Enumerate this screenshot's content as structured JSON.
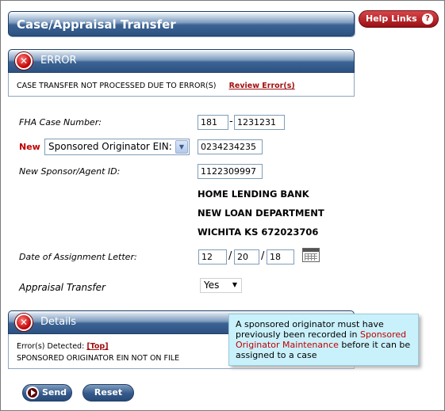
{
  "header": {
    "title": "Case/Appraisal Transfer",
    "help_label": "Help Links",
    "help_icon": "?"
  },
  "error_section": {
    "title": "ERROR",
    "message": "CASE TRANSFER NOT PROCESSED DUE TO ERROR(S)",
    "review_link": "Review Error(s)"
  },
  "form": {
    "fha_label": "FHA Case Number:",
    "fha_part1": "181",
    "fha_sep": "-",
    "fha_part2": "1231231",
    "new_label": "New",
    "originator_select": "Sponsored Originator EIN:",
    "originator_value": "0234234235",
    "sponsor_label": "New Sponsor/Agent ID:",
    "sponsor_value": "1122309997",
    "sponsor_name": "HOME LENDING BANK",
    "sponsor_dept": "NEW LOAN DEPARTMENT",
    "sponsor_city": "WICHITA KS 672023706",
    "date_label": "Date of Assignment Letter:",
    "date_month": "12",
    "date_day": "20",
    "date_year": "18",
    "date_sep": "/",
    "appraisal_label": "Appraisal Transfer",
    "appraisal_value": "Yes"
  },
  "details_section": {
    "title": "Details",
    "errors_detected": "Error(s) Detected:",
    "top_link": "[Top]",
    "error_text": "SPONSORED ORIGINATOR EIN NOT ON FILE"
  },
  "tooltip": {
    "part1": "A sponsored originator must have previously been recorded in ",
    "link": "Sponsored Originator Maintenance",
    "part2": " before it can be assigned to a case"
  },
  "buttons": {
    "send": "Send",
    "reset": "Reset"
  },
  "colors": {
    "header_blue": "#2c5282",
    "error_red": "#c00000",
    "tooltip_bg": "#c9f1fb"
  }
}
